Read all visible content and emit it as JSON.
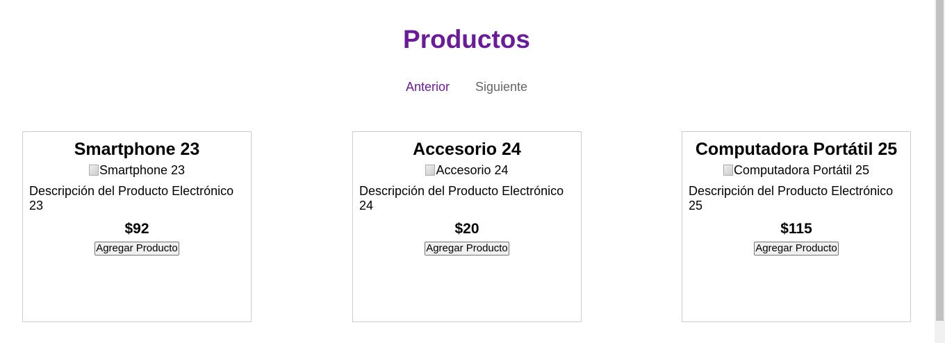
{
  "page": {
    "title": "Productos",
    "pagination": {
      "prev_label": "Anterior",
      "next_label": "Siguiente"
    }
  },
  "products": [
    {
      "name": "Smartphone 23",
      "image_alt": "Smartphone 23",
      "description": "Descripción del Producto Electrónico 23",
      "price": "$92",
      "button_label": "Agregar Producto"
    },
    {
      "name": "Accesorio 24",
      "image_alt": "Accesorio 24",
      "description": "Descripción del Producto Electrónico 24",
      "price": "$20",
      "button_label": "Agregar Producto"
    },
    {
      "name": "Computadora Portátil 25",
      "image_alt": "Computadora Portátil 25",
      "description": "Descripción del Producto Electrónico 25",
      "price": "$115",
      "button_label": "Agregar Producto"
    }
  ],
  "colors": {
    "accent": "#6a1b9a",
    "muted_link": "#666666",
    "card_border": "#cccccc"
  }
}
